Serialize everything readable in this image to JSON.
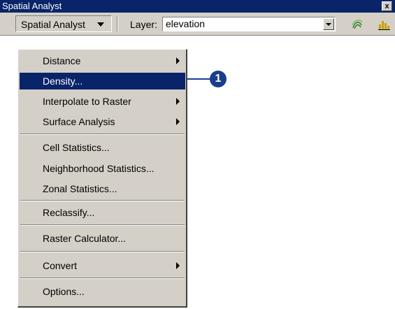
{
  "window": {
    "title": "Spatial Analyst",
    "close_symbol": "x"
  },
  "toolbar": {
    "menu_label": "Spatial Analyst",
    "layer_label": "Layer:",
    "layer_value": "elevation"
  },
  "menu": {
    "items": [
      {
        "label": "Distance",
        "submenu": true
      },
      {
        "label": "Density...",
        "submenu": false
      },
      {
        "label": "Interpolate to Raster",
        "submenu": true
      },
      {
        "label": "Surface Analysis",
        "submenu": true
      },
      {
        "label": "Cell Statistics...",
        "submenu": false
      },
      {
        "label": "Neighborhood Statistics...",
        "submenu": false
      },
      {
        "label": "Zonal Statistics...",
        "submenu": false
      },
      {
        "label": "Reclassify...",
        "submenu": false
      },
      {
        "label": "Raster Calculator...",
        "submenu": false
      },
      {
        "label": "Convert",
        "submenu": true
      },
      {
        "label": "Options...",
        "submenu": false
      }
    ],
    "selected": "Density..."
  },
  "callout": {
    "number": "1",
    "color": "#1a3e8c"
  },
  "colors": {
    "titlebar": "#0a246a",
    "selection": "#0a246a",
    "face": "#d4d0c8"
  }
}
